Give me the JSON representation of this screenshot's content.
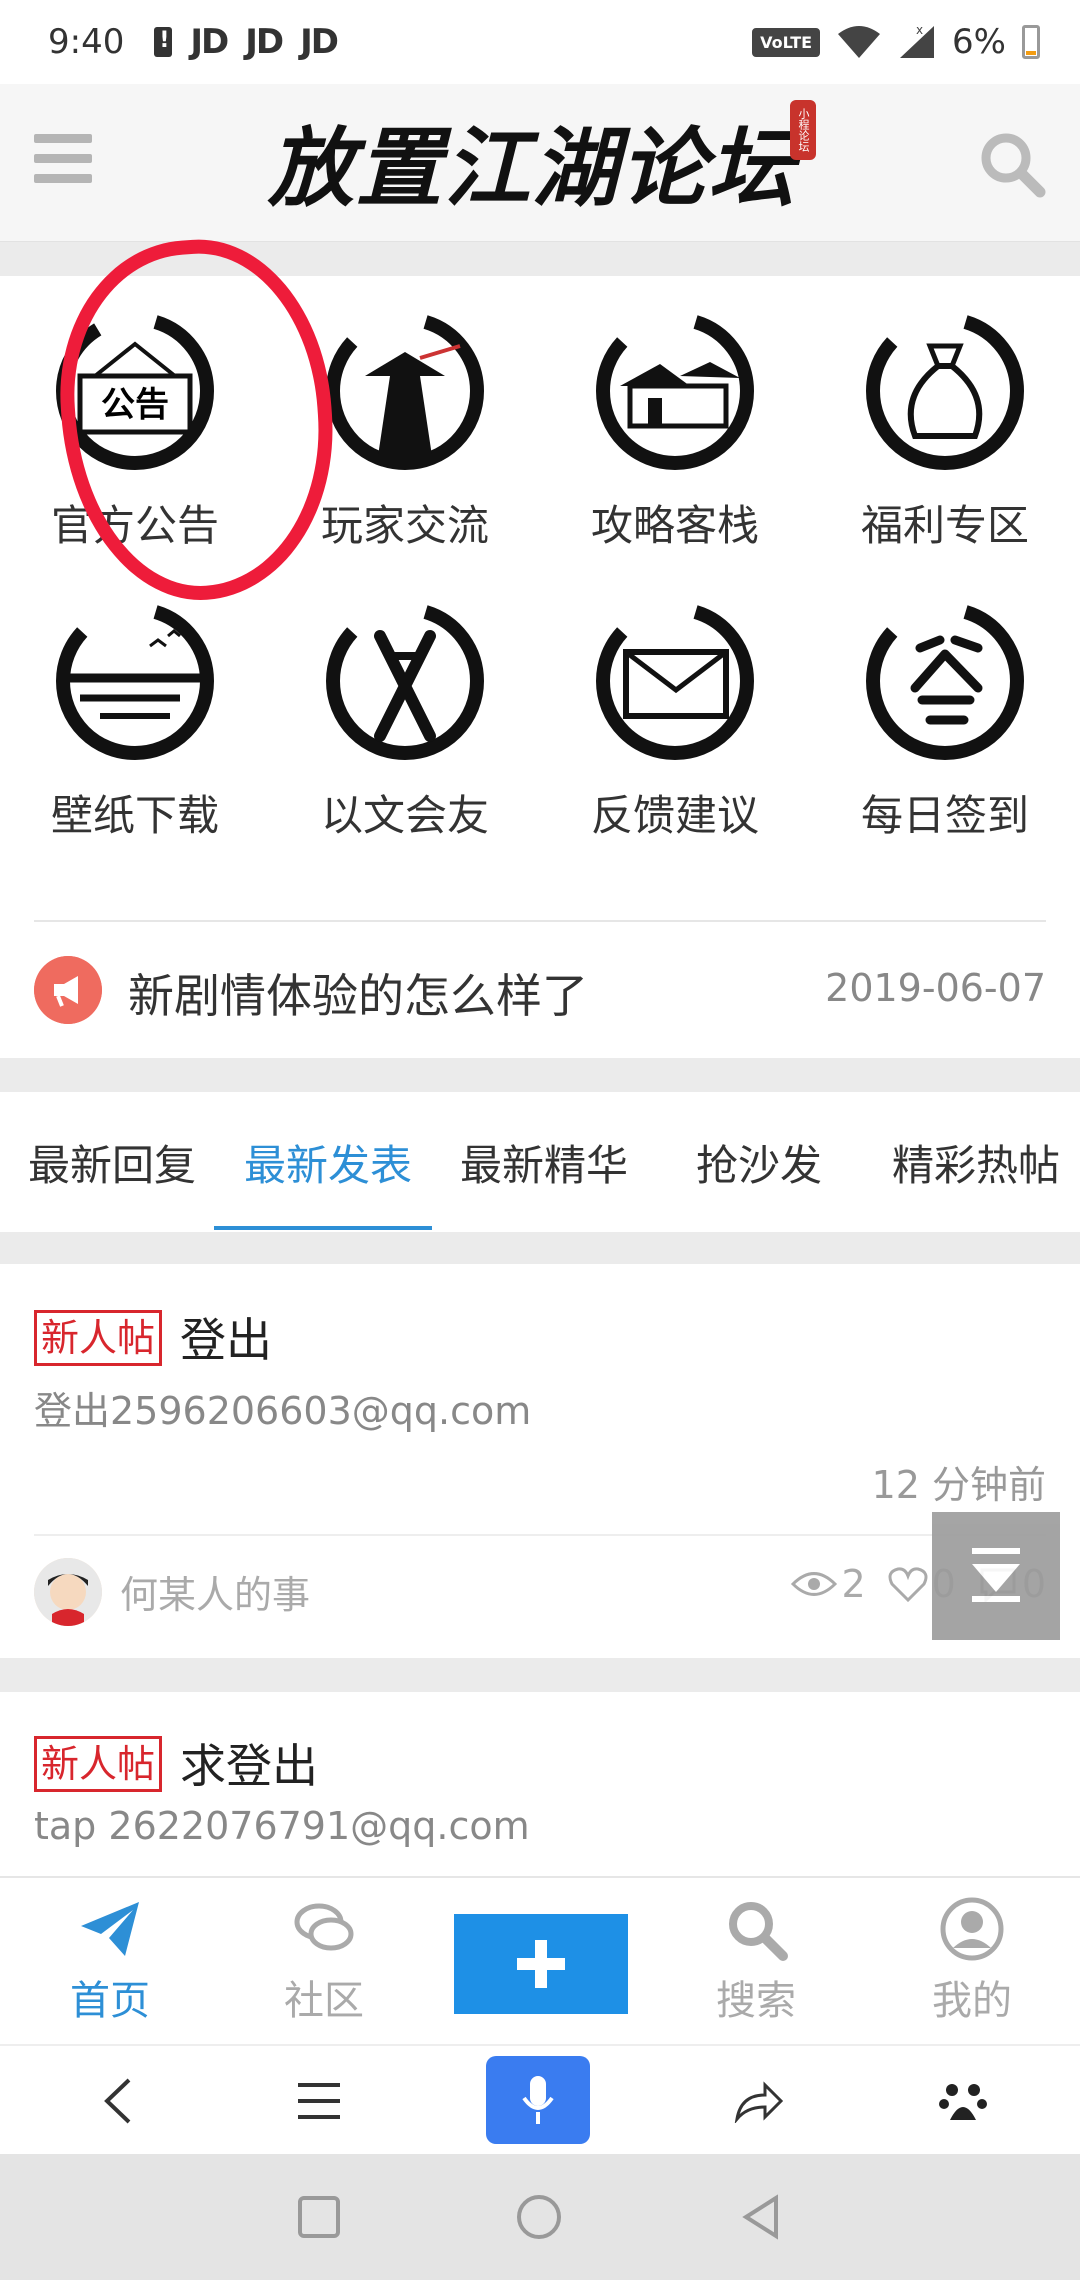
{
  "status_bar": {
    "time": "9:40",
    "notifications": [
      "JD",
      "JD",
      "JD"
    ],
    "volte": "VoLTE",
    "battery": "6%"
  },
  "header": {
    "logo_text": "放置江湖论坛",
    "seal_text": "小程论坛"
  },
  "categories": [
    {
      "label": "官方公告",
      "icon": "announcement-plaque-icon"
    },
    {
      "label": "玩家交流",
      "icon": "swordsman-icon"
    },
    {
      "label": "攻略客栈",
      "icon": "inn-icon"
    },
    {
      "label": "福利专区",
      "icon": "money-bag-icon"
    },
    {
      "label": "壁纸下载",
      "icon": "landscape-birds-icon"
    },
    {
      "label": "以文会友",
      "icon": "writing-glyph-icon"
    },
    {
      "label": "反馈建议",
      "icon": "envelope-icon"
    },
    {
      "label": "每日签到",
      "icon": "sign-in-glyph-icon"
    }
  ],
  "notice": {
    "text": "新剧情体验的怎么样了",
    "date": "2019-06-07"
  },
  "tabs": [
    {
      "label": "最新回复"
    },
    {
      "label": "最新发表",
      "active": true
    },
    {
      "label": "最新精华"
    },
    {
      "label": "抢沙发"
    },
    {
      "label": "精彩热帖"
    }
  ],
  "posts": [
    {
      "badge": "新人帖",
      "title": "登出",
      "excerpt": "登出2596206603@qq.com",
      "time": "12 分钟前",
      "author": "何某人的事",
      "views": "2",
      "likes": "0",
      "comments": "0"
    },
    {
      "badge": "新人帖",
      "title": "求登出",
      "excerpt": "tap 2622076791@qq.com"
    }
  ],
  "bottom_nav": [
    {
      "label": "首页",
      "icon": "paper-plane-icon",
      "active": true
    },
    {
      "label": "社区",
      "icon": "chat-bubbles-icon"
    },
    {
      "label": "",
      "icon": "plus-icon"
    },
    {
      "label": "搜索",
      "icon": "search-icon"
    },
    {
      "label": "我的",
      "icon": "user-icon"
    }
  ],
  "colors": {
    "accent_blue": "#2d8fd6",
    "badge_red": "#d8262d",
    "annotation_red": "#ee1c3a",
    "notice_icon": "#ef6b5f"
  }
}
